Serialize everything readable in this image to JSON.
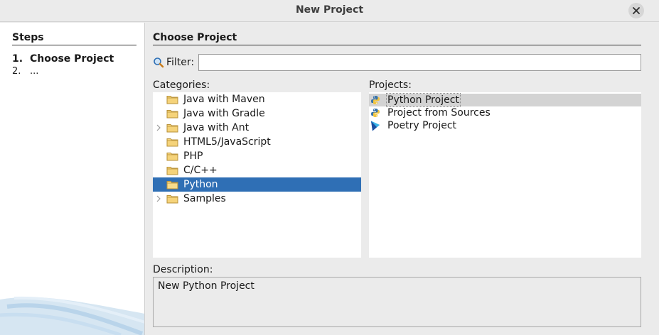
{
  "window": {
    "title": "New Project"
  },
  "steps": {
    "heading": "Steps",
    "items": [
      {
        "num": "1.",
        "label": "Choose Project"
      },
      {
        "num": "2.",
        "label": "..."
      }
    ]
  },
  "main": {
    "heading": "Choose Project",
    "filter": {
      "label": "Filter:",
      "value": "",
      "placeholder": ""
    },
    "categories_label": "Categories:",
    "projects_label": "Projects:",
    "categories": [
      {
        "label": "Java with Maven",
        "expandable": false,
        "selected": false
      },
      {
        "label": "Java with Gradle",
        "expandable": false,
        "selected": false
      },
      {
        "label": "Java with Ant",
        "expandable": true,
        "selected": false
      },
      {
        "label": "HTML5/JavaScript",
        "expandable": false,
        "selected": false
      },
      {
        "label": "PHP",
        "expandable": false,
        "selected": false
      },
      {
        "label": "C/C++",
        "expandable": false,
        "selected": false
      },
      {
        "label": "Python",
        "expandable": false,
        "selected": true
      },
      {
        "label": "Samples",
        "expandable": true,
        "selected": false
      }
    ],
    "projects": [
      {
        "label": "Python Project",
        "icon": "python-icon",
        "selected": true
      },
      {
        "label": "Project from Sources",
        "icon": "python-icon",
        "selected": false
      },
      {
        "label": "Poetry Project",
        "icon": "poetry-icon",
        "selected": false
      }
    ],
    "description_label": "Description:",
    "description": "New Python Project"
  },
  "colors": {
    "selection": "#2f6fb5",
    "folder": "#f5d37a",
    "python_blue": "#3a73a8",
    "python_yellow": "#f2c53d",
    "poetry": "#2a7bd8"
  }
}
